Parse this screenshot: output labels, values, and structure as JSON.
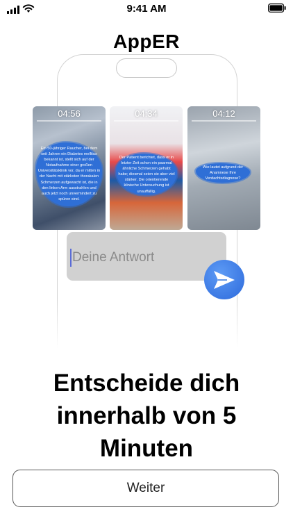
{
  "status_bar": {
    "time": "9:41 AM",
    "icons": [
      "cellular-signal-icon",
      "wifi-icon",
      "battery-icon"
    ]
  },
  "app": {
    "title": "AppER"
  },
  "videos": [
    {
      "duration": "04:56",
      "text": "Ein 50-jähriger Raucher, bei dem seit Jahren ein Diabetes mellitus bekannt ist, stellt sich auf der Notaufnahme einer großen Universitätsklinik vor, da er mitten in der Nacht mit stärksten thorakalen Schmerzen aufgewacht ist, die in den linken Arm ausstrahlen und auch jetzt noch unvermindert zu spüren sind."
    },
    {
      "duration": "04:34",
      "text": "Der Patient berichtet, dass er in letzter Zeit schon ein paarmal ähnliche Schmerzen gehabt habe; diesmal seien sie aber viel stärker. Die orientierende klinische Untersuchung ist unauffällig."
    },
    {
      "duration": "04:12",
      "text": "Wie lautet aufgrund der Anamnese Ihre Verdachtsdiagnose?"
    }
  ],
  "answer": {
    "placeholder": "Deine Antwort"
  },
  "accent_color": "#2f6fd6",
  "headline": {
    "line1": "Entscheide dich",
    "line2": "innerhalb von 5",
    "line3": "Minuten"
  },
  "buttons": {
    "next_label": "Weiter"
  }
}
